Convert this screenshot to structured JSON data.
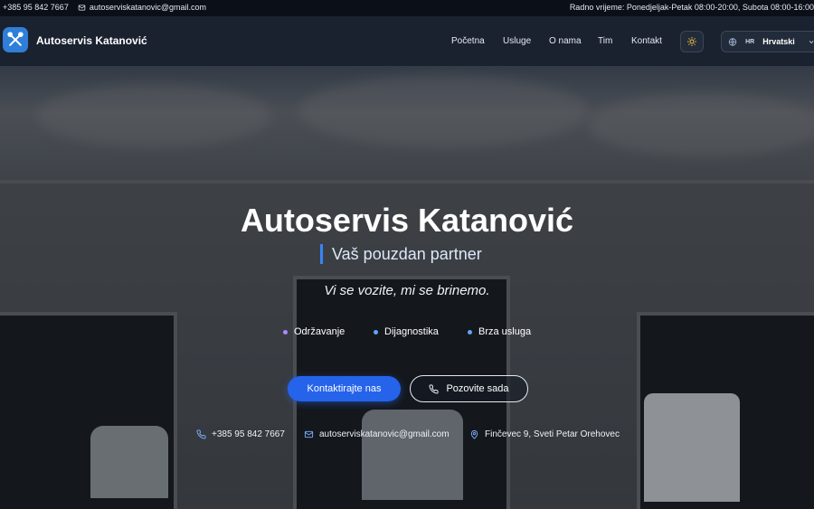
{
  "topbar": {
    "phone": "+385 95 842 7667",
    "email": "autoserviskatanovic@gmail.com",
    "hours": "Radno vrijeme: Ponedjeljak-Petak 08:00-20:00, Subota 08:00-16:00"
  },
  "nav": {
    "brand": "Autoservis Katanović",
    "items": [
      "Početna",
      "Usluge",
      "O nama",
      "Tim",
      "Kontakt"
    ],
    "lang_code": "HR",
    "lang_label": "Hrvatski"
  },
  "hero": {
    "title": "Autoservis Katanović",
    "subtitle": "Vaš pouzdan partner",
    "tagline": "Vi se vozite, mi se brinemo.",
    "features": [
      {
        "label": "Održavanje",
        "color": "#a78bfa"
      },
      {
        "label": "Dijagnostika",
        "color": "#60a5fa"
      },
      {
        "label": "Brza usluga",
        "color": "#60a5fa"
      }
    ],
    "primary_button": "Kontaktirajte nas",
    "secondary_button": "Pozovite sada",
    "contact_phone": "+385 95 842 7667",
    "contact_email": "autoserviskatanovic@gmail.com",
    "contact_address": "Finčevec 9, Sveti Petar Orehovec"
  },
  "colors": {
    "accent": "#2563eb",
    "nav_bg": "#1a2230"
  }
}
